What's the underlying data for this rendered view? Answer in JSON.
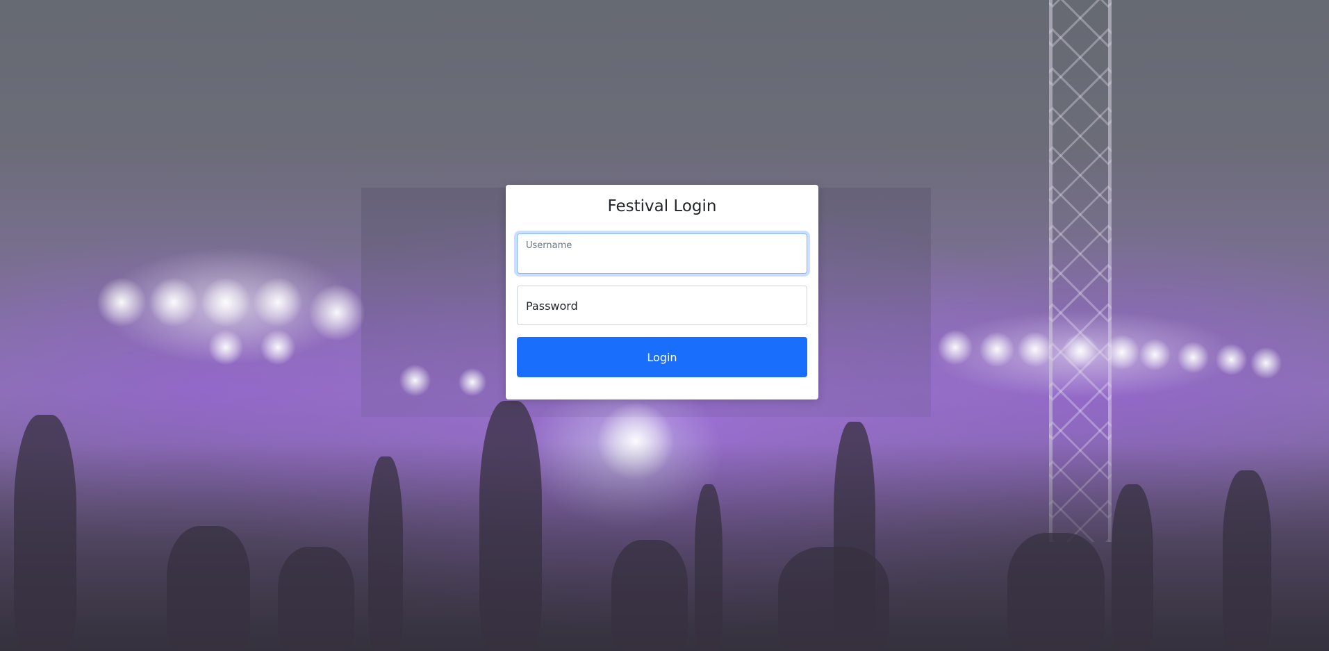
{
  "page": {
    "background": "concert-crowd-photo"
  },
  "login": {
    "title": "Festival Login",
    "username_label": "Username",
    "username_value": "",
    "password_placeholder": "Password",
    "password_value": "",
    "submit_label": "Login"
  },
  "colors": {
    "primary": "#1a6efc",
    "focus_border": "#86b7fe",
    "card_background": "#ffffff"
  }
}
